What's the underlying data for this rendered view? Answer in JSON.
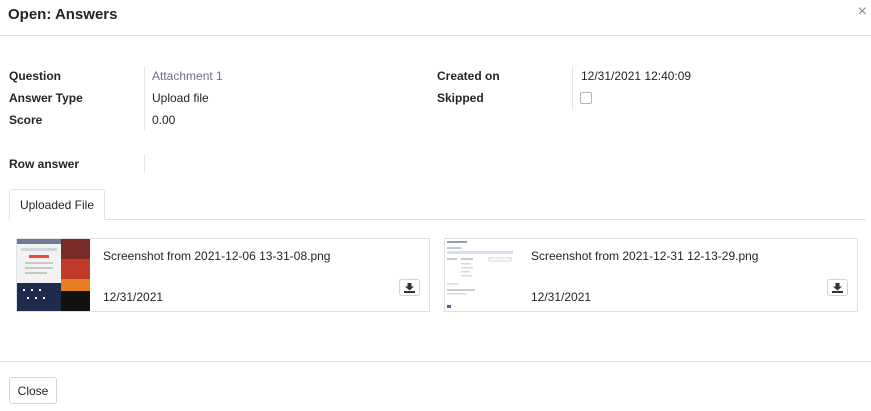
{
  "dialog": {
    "title": "Open: Answers",
    "close_icon": "×"
  },
  "fields": {
    "question_label": "Question",
    "question_value": "Attachment 1",
    "answer_type_label": "Answer Type",
    "answer_type_value": "Upload file",
    "score_label": "Score",
    "score_value": "0.00",
    "created_on_label": "Created on",
    "created_on_value": "12/31/2021 12:40:09",
    "skipped_label": "Skipped",
    "skipped_value": false,
    "row_answer_label": "Row answer",
    "row_answer_value": ""
  },
  "tabs": [
    {
      "label": "Uploaded File",
      "active": true
    }
  ],
  "attachments": [
    {
      "name": "Screenshot from 2021-12-06 13-31-08.png",
      "date": "12/31/2021",
      "icon": "download-icon"
    },
    {
      "name": "Screenshot from 2021-12-31 12-13-29.png",
      "date": "12/31/2021",
      "icon": "download-icon"
    }
  ],
  "footer": {
    "close_label": "Close"
  },
  "colors": {
    "link": "#6b6f8c",
    "border": "#dee2e6",
    "thumb_dark": "#1e2b4d",
    "thumb_orange": "#c0392b"
  }
}
